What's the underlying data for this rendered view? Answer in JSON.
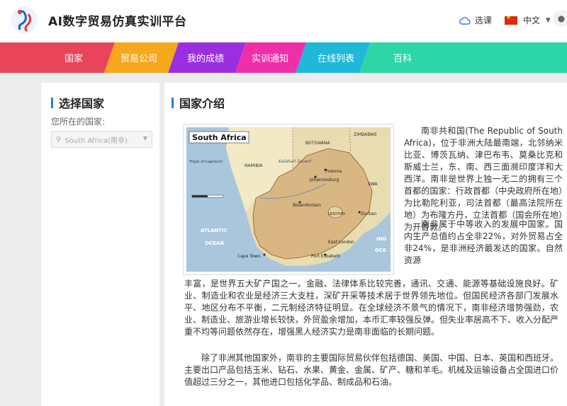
{
  "header": {
    "app_title": "AI数字贸易仿真实训平台",
    "select_course_label": "选课",
    "language_label": "中文"
  },
  "nav": {
    "tabs": [
      {
        "label": "国家",
        "color": "#e8455a"
      },
      {
        "label": "贸易公司",
        "color": "#f5a81c"
      },
      {
        "label": "我的成绩",
        "color": "#9b2fe0"
      },
      {
        "label": "实训通知",
        "color": "#ee2fa8"
      },
      {
        "label": "在线列表",
        "color": "#1fb8d8"
      },
      {
        "label": "百科",
        "color": "#2cd6a6"
      }
    ]
  },
  "left": {
    "title": "选择国家",
    "country_label": "您所在的国家:",
    "country_value": "South Africa(南非)"
  },
  "main": {
    "title": "国家介绍",
    "map": {
      "title": "South Africa",
      "labels": {
        "zimbabwe": "ZIMBABWE",
        "botswana": "BOTSWANA",
        "namibia": "NAMIBIA",
        "kalahari": "Kalahari Desert",
        "atlantic": "ATLANTIC",
        "ocean": "OCEAN",
        "ind": "IND",
        "oce": "OCE",
        "johannesburg": "Johannesburg",
        "pretoria": "Pretoria",
        "bloemfontein": "Bloemfontein",
        "lesotho": "LESOTHO",
        "durban": "Durban",
        "capetown": "Cape Town",
        "port_elizabeth": "Port Elizabeth",
        "east_london": "East London",
        "swaziland": "SWA",
        "tropic": "Tropic of Capricorn"
      }
    },
    "paragraphs": {
      "p1": "南非共和国(The Republic of South Africa)，位于非洲大陆最南端，北邻纳米比亚、博茨瓦纳、津巴布韦、莫桑比克和斯威士兰，东、南、西三面濒印度洋和大西洋。南非是世界上独一无二的拥有三个首都的国家：行政首都（中央政府所在地）为比勒陀利亚，司法首都（最高法院所在地）为布隆方丹，立法首都（国会所在地）为开普敦。",
      "p2": "南非属于中等收入的发展中国家。国内生产总值约占全非22%，对外贸易占全非24%，是非洲经济最发达的国家。自然资源",
      "p3": "丰富，是世界五大矿产国之一。金融、法律体系比较完善，通讯、交通、能源等基础设施良好。矿业、制造业和农业是经济三大支柱，深矿开采等技术居于世界领先地位。但国民经济各部门发展水平、地区分布不平衡，二元制经济特征明显。在全球经济不景气的情况下，南非经济增势强劲，农业、制造业、旅游业增长较快，外贸盈余增加，本币汇率较强反弹。但失业率居高不下、收入分配严重不均等问题依然存在，增强黑人经济实力是南非面临的长期问题。",
      "p4": "除了非洲其他国家外，南非的主要国际贸易伙伴包括德国、美国、中国、日本、英国和西班牙。主要出口产品包括玉米、钻石、水果、黄金、金属、矿产、糖和羊毛。机械及运输设备占全国进口价值超过三分之一，其他进口包括化学品、制成品和石油。"
    }
  }
}
